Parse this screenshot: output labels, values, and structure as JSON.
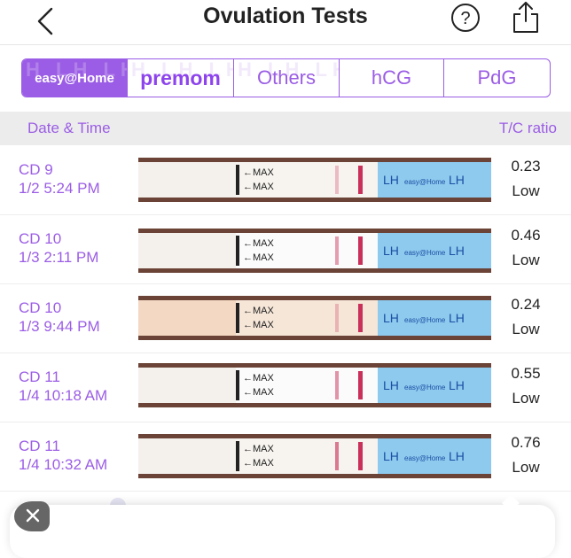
{
  "header": {
    "title": "Ovulation Tests",
    "icons": {
      "back": "chevron-left-icon",
      "help": "question-mark-icon",
      "share": "share-icon"
    }
  },
  "tabs": [
    {
      "label": "easy@Home",
      "selected": true
    },
    {
      "label": "premom",
      "selected": false
    },
    {
      "label": "Others",
      "selected": false
    },
    {
      "label": "hCG",
      "selected": false
    },
    {
      "label": "PdG",
      "selected": false
    }
  ],
  "tab_watermark": "H LH LH",
  "columns": {
    "left": "Date & Time",
    "right": "T/C ratio"
  },
  "strip_text": {
    "max": "←MAX",
    "lh": "LH",
    "brand": "easy@Home"
  },
  "tests": [
    {
      "cycle_day": "CD 9",
      "datetime": "1/2 5:24 PM",
      "ratio": "0.23",
      "level": "Low",
      "test_line_opacity": 0.35
    },
    {
      "cycle_day": "CD 10",
      "datetime": "1/3 2:11 PM",
      "ratio": "0.46",
      "level": "Low",
      "test_line_opacity": 0.55
    },
    {
      "cycle_day": "CD 10",
      "datetime": "1/3 9:44 PM",
      "ratio": "0.24",
      "level": "Low",
      "test_line_opacity": 0.35
    },
    {
      "cycle_day": "CD 11",
      "datetime": "1/4 10:18 AM",
      "ratio": "0.55",
      "level": "Low",
      "test_line_opacity": 0.6
    },
    {
      "cycle_day": "CD 11",
      "datetime": "1/4 10:32 AM",
      "ratio": "0.76",
      "level": "Low",
      "test_line_opacity": 0.75
    }
  ],
  "colors": {
    "accent": "#9b5de5",
    "control_line": "#c9305a",
    "test_line": "#d05070",
    "strip_blue": "#8ec9ee"
  }
}
